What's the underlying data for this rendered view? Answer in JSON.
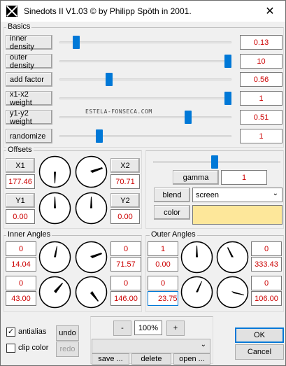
{
  "window": {
    "title": "Sinedots II V1.03 © by Philipp Spöth in 2001.",
    "close_glyph": "✕"
  },
  "watermark": "ESTELA-FONSECA.COM",
  "basics": {
    "label": "Basics",
    "rows": [
      {
        "name": "inner density",
        "value": "0.13",
        "level": 0.08
      },
      {
        "name": "outer density",
        "value": "10",
        "level": 1.0
      },
      {
        "name": "add factor",
        "value": "0.56",
        "level": 0.28
      },
      {
        "name": "x1-x2 weight",
        "value": "1",
        "level": 1.0
      },
      {
        "name": "y1-y2 weight",
        "value": "0.51",
        "level": 0.76
      },
      {
        "name": "randomize",
        "value": "1",
        "level": 0.22
      }
    ]
  },
  "offsets": {
    "label": "Offsets",
    "x1_label": "X1",
    "x1_value": "177.46",
    "x2_label": "X2",
    "x2_value": "70.71",
    "y1_label": "Y1",
    "y1_value": "0.00",
    "y2_label": "Y2",
    "y2_value": "0.00"
  },
  "render": {
    "gamma_label": "gamma",
    "gamma_value": "1",
    "gamma_level": 0.48,
    "blend_label": "blend",
    "blend_value": "screen",
    "color_label": "color",
    "color_value": "#fde79a"
  },
  "inner_angles": {
    "label": "Inner Angles",
    "a1": "0",
    "a1b": "14.04",
    "a2": "0",
    "a2b": "71.57",
    "a3": "0",
    "a3b": "43.00",
    "a4": "0",
    "a4b": "146.00"
  },
  "outer_angles": {
    "label": "Outer Angles",
    "a1": "1",
    "a1b": "0.00",
    "a2": "0",
    "a2b": "333.43",
    "a3": "0",
    "a3b": "23.75",
    "a4": "0",
    "a4b": "106.00"
  },
  "bottom": {
    "antialias_label": "antialias",
    "antialias_checked": "✓",
    "clip_label": "clip color",
    "undo_label": "undo",
    "redo_label": "redo",
    "minus_label": "-",
    "zoom_value": "100%",
    "plus_label": "+",
    "save_label": "save ...",
    "delete_label": "delete",
    "open_label": "open ...",
    "ok_label": "OK",
    "cancel_label": "Cancel"
  },
  "colors": {
    "accent": "#0078d7",
    "value_text": "#cc0000"
  }
}
